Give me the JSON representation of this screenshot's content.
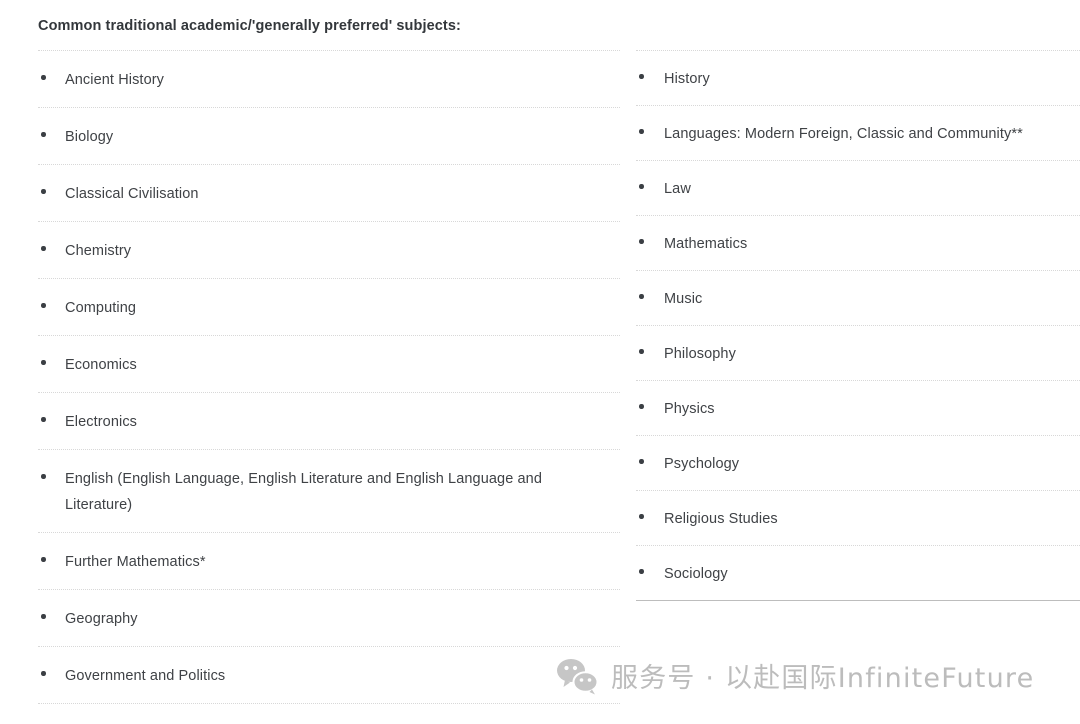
{
  "heading": "Common traditional academic/'generally preferred' subjects:",
  "columns": {
    "left": {
      "items": [
        "Ancient History",
        "Biology",
        "Classical Civilisation",
        "Chemistry",
        "Computing",
        "Economics",
        "Electronics",
        "English (English Language, English Literature and English Language and Literature)",
        "Further Mathematics*",
        "Geography",
        "Government and Politics"
      ],
      "end_rule": "dotted"
    },
    "right": {
      "items": [
        "History",
        "Languages: Modern Foreign, Classic and Community**",
        "Law",
        "Mathematics",
        "Music",
        "Philosophy",
        "Physics",
        "Psychology",
        "Religious Studies",
        "Sociology"
      ],
      "end_rule": "solid"
    }
  },
  "watermark": {
    "icon": "wechat-icon",
    "text": "服务号 · 以赴国际InfiniteFuture"
  },
  "colors": {
    "heading_text": "#33373b",
    "body_text": "#3f4246",
    "bullet": "#3b3f44",
    "divider_dotted": "#d8d8d8",
    "divider_solid": "#bdbdbd",
    "watermark": "#bcbcbc",
    "background": "#ffffff"
  }
}
